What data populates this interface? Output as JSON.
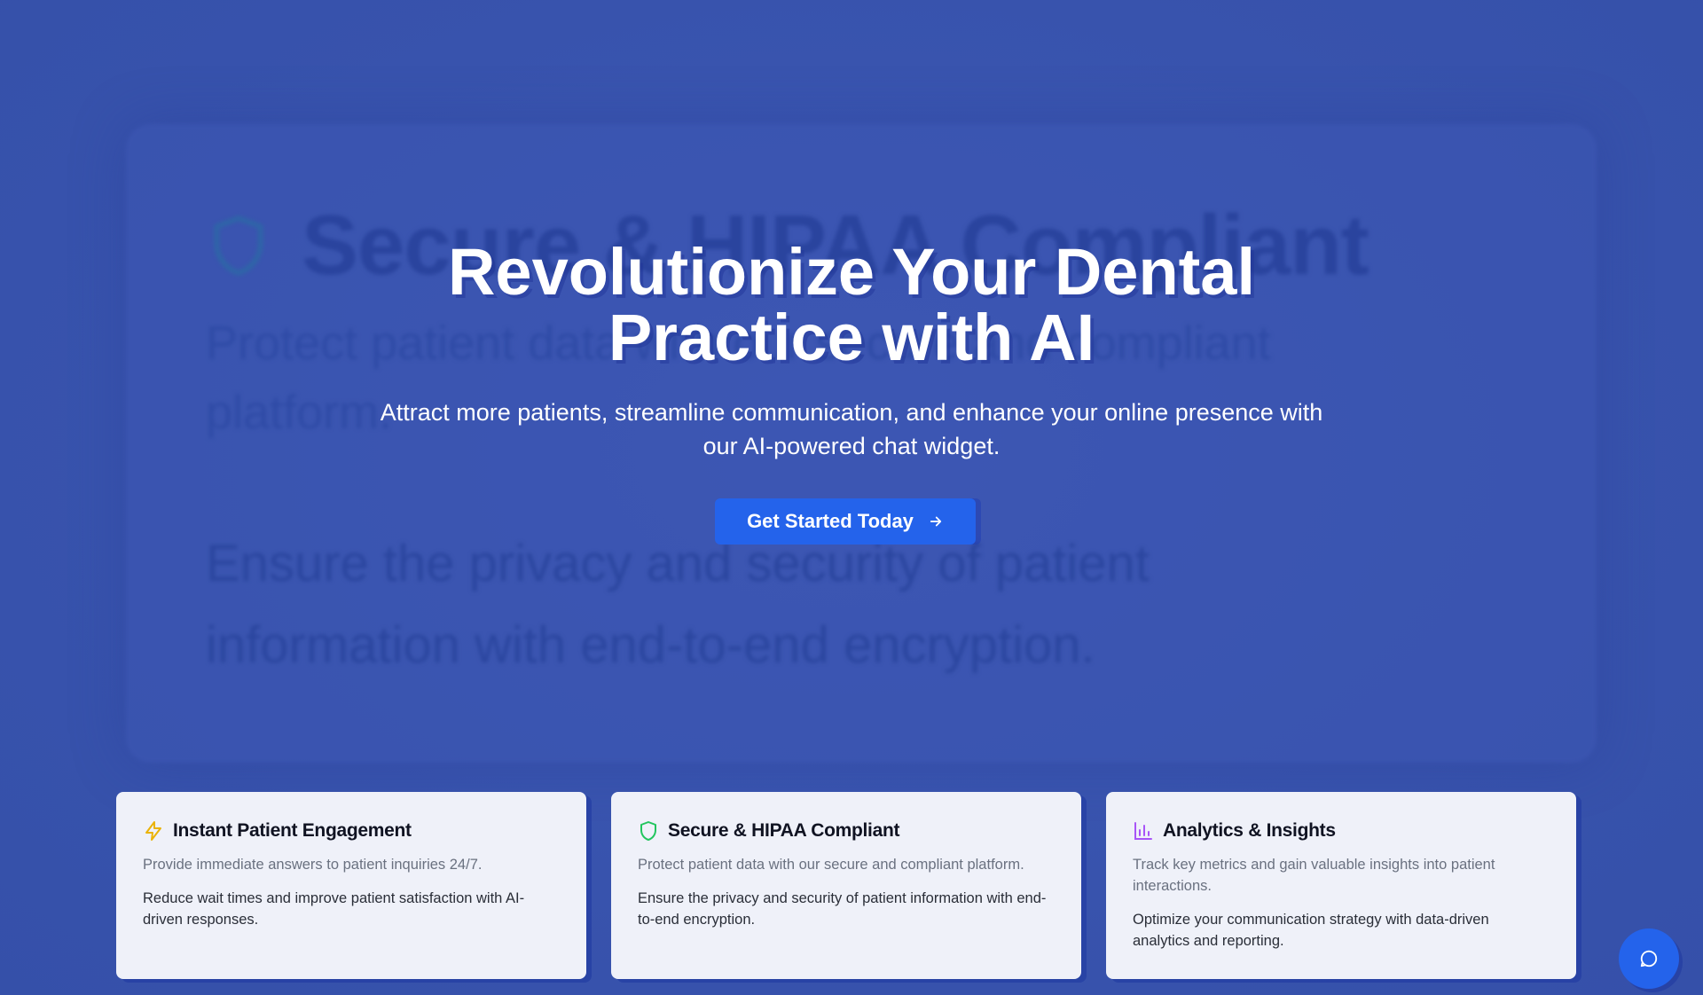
{
  "background": {
    "title": "Secure & HIPAA Compliant",
    "subtitle": "Protect patient data with our secure and compliant platform.",
    "body": "Ensure the privacy and security of patient information with end-to-end encryption.",
    "icon": "shield-icon"
  },
  "hero": {
    "title": "Revolutionize Your Dental Practice with AI",
    "subtitle": "Attract more patients, streamline communication, and enhance your online presence with our AI-powered chat widget.",
    "cta_label": "Get Started Today",
    "cta_icon": "arrow-right-icon"
  },
  "features": [
    {
      "icon": "lightning-icon",
      "icon_color": "#eab308",
      "title": "Instant Patient Engagement",
      "description": "Provide immediate answers to patient inquiries 24/7.",
      "body": "Reduce wait times and improve patient satisfaction with AI-driven responses."
    },
    {
      "icon": "shield-icon",
      "icon_color": "#22c55e",
      "title": "Secure & HIPAA Compliant",
      "description": "Protect patient data with our secure and compliant platform.",
      "body": "Ensure the privacy and security of patient information with end-to-end encryption."
    },
    {
      "icon": "bar-chart-icon",
      "icon_color": "#a855f7",
      "title": "Analytics & Insights",
      "description": "Track key metrics and gain valuable insights into patient interactions.",
      "body": "Optimize your communication strategy with data-driven analytics and reporting."
    }
  ],
  "chat_widget": {
    "icon": "chat-bubble-icon"
  },
  "colors": {
    "background": "#3a55b0",
    "accent": "#2463eb",
    "card": "#eff1f9"
  }
}
